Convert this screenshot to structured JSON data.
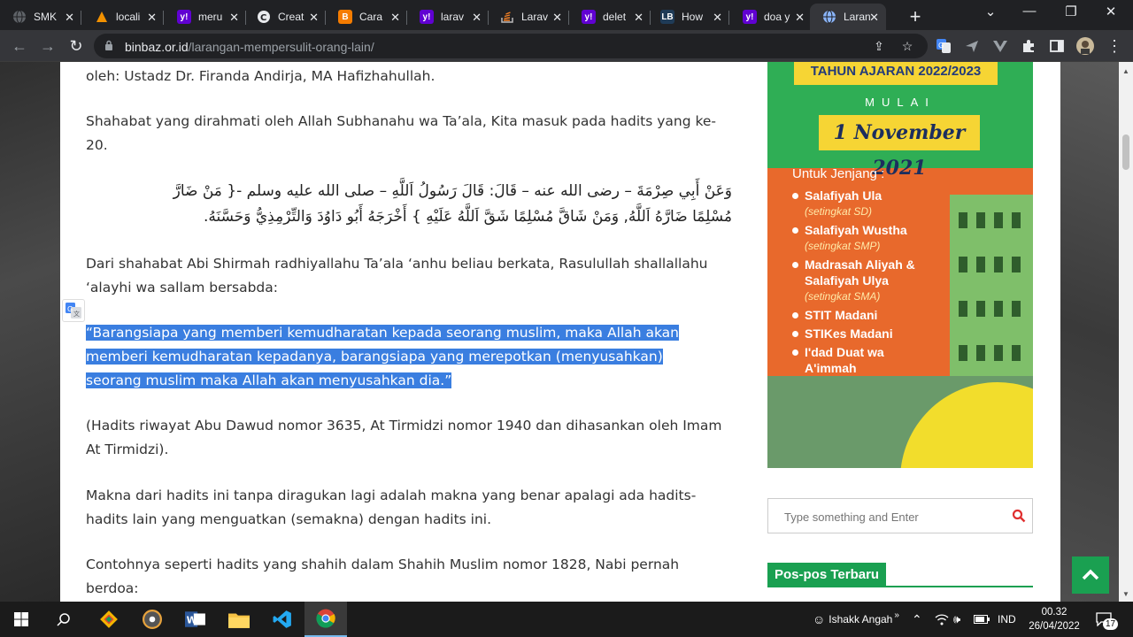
{
  "browser": {
    "tabs": [
      {
        "title": "SMK",
        "favicon_color": "#5f6368",
        "favicon_glyph": "globe"
      },
      {
        "title": "locali",
        "favicon_color": "#f29100",
        "favicon_glyph": "xampp"
      },
      {
        "title": "meru",
        "favicon_color": "#6001d2",
        "favicon_glyph": "y!"
      },
      {
        "title": "Creat",
        "favicon_color": "#e8eaed",
        "favicon_glyph": "C"
      },
      {
        "title": "Cara",
        "favicon_color": "#f57c00",
        "favicon_glyph": "B"
      },
      {
        "title": "larav",
        "favicon_color": "#6001d2",
        "favicon_glyph": "y!"
      },
      {
        "title": "Larav",
        "favicon_color": "#f48024",
        "favicon_glyph": "stack"
      },
      {
        "title": "delet",
        "favicon_color": "#6001d2",
        "favicon_glyph": "y!"
      },
      {
        "title": "How",
        "favicon_color": "#1f3b57",
        "favicon_glyph": "LB"
      },
      {
        "title": "doa y",
        "favicon_color": "#6001d2",
        "favicon_glyph": "y!"
      },
      {
        "title": "Laran",
        "favicon_color": "#8ab4f8",
        "favicon_glyph": "globe",
        "active": true
      }
    ],
    "new_tab_label": "+",
    "url_host": "binbaz.or.id",
    "url_path": "/larangan-mempersulit-orang-lain/"
  },
  "article": {
    "p1": "oleh: Ustadz Dr. Firanda Andirja, MA Hafizhahullah.",
    "p2": "Shahabat yang dirahmati oleh Allah Subhanahu wa Ta’ala, Kita masuk pada hadits yang ke-20.",
    "arabic_line1": "وَعَنْ أَبِي صِرْمَةَ – رضى الله عنه – قَالَ: قَالَ رَسُولُ اَللَّهِ – صلى الله عليه وسلم -{ مَنْ ضَارَّ",
    "arabic_line2": "مُسْلِمًا ضَارَّهُ اَللَّهُ, وَمَنْ شَاقَّ مُسْلِمًا شَقَّ اَللَّهُ عَلَيْهِ } أَخْرَجَهُ أَبُو دَاوُدَ وَالتِّرْمِذِيُّ وَحَسَّنَهُ.",
    "p3": "Dari shahabat Abi Shirmah radhiyallahu Ta’ala ‘anhu beliau berkata, Rasulullah shallallahu ‘alayhi wa sallam bersabda:",
    "quote_line1": "“Barangsiapa yang memberi kemudharatan kepada seorang muslim, maka Allah akan",
    "quote_line2": "memberi kemudharatan kepadanya, barangsiapa yang merepotkan (menyusahkan)",
    "quote_line3": "seorang muslim maka Allah akan menyusahkan dia.”",
    "p4": "(Hadits riwayat Abu Dawud nomor 3635, At Tirmidzi nomor 1940 dan dihasankan oleh Imam At Tirmidzi).",
    "p5": "Makna dari hadits ini tanpa diragukan lagi adalah makna yang benar apalagi ada hadits-hadits lain yang menguatkan (semakna) dengan hadits ini.",
    "p6": "Contohnya seperti hadits yang shahih dalam Shahih Muslim nomor 1828, Nabi pernah berdoa:"
  },
  "sidebar": {
    "banner": {
      "year": "TAHUN AJARAN 2022/2023",
      "mulai": "MULAI",
      "date": "1 November 2021",
      "jenjang_heading": "Untuk Jenjang :",
      "levels": [
        {
          "name": "Salafiyah Ula",
          "sub": "(setingkat SD)"
        },
        {
          "name": "Salafiyah Wustha",
          "sub": "(setingkat SMP)"
        },
        {
          "name": "Madrasah Aliyah & Salafiyah Ulya",
          "sub": "(setingkat SMA)"
        },
        {
          "name": "STIT Madani",
          "sub": ""
        },
        {
          "name": "STIKes Madani",
          "sub": ""
        },
        {
          "name": "I'dad Duat wa A'immah",
          "sub": ""
        }
      ]
    },
    "search_placeholder": "Type something and Enter",
    "recent_heading": "Pos-pos Terbaru"
  },
  "taskbar": {
    "user": "Ishakk Angah",
    "lang": "IND",
    "time": "00.32",
    "date": "26/04/2022",
    "notifications": "17"
  },
  "colors": {
    "accent_green": "#1aa051",
    "selection": "#3a7ee0",
    "banner_orange": "#e8692c"
  }
}
